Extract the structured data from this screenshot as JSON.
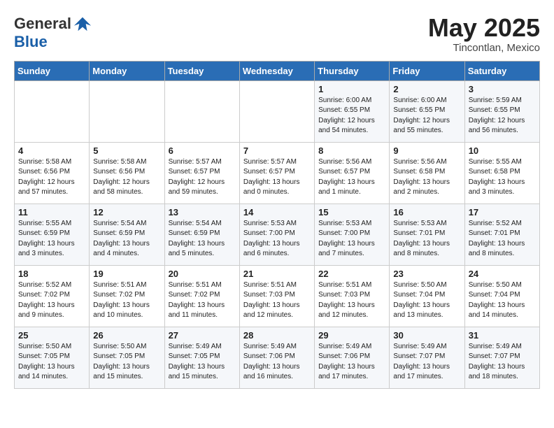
{
  "header": {
    "logo_line1": "General",
    "logo_line2": "Blue",
    "title": "May 2025",
    "subtitle": "Tincontlan, Mexico"
  },
  "weekdays": [
    "Sunday",
    "Monday",
    "Tuesday",
    "Wednesday",
    "Thursday",
    "Friday",
    "Saturday"
  ],
  "weeks": [
    [
      {
        "num": "",
        "info": ""
      },
      {
        "num": "",
        "info": ""
      },
      {
        "num": "",
        "info": ""
      },
      {
        "num": "",
        "info": ""
      },
      {
        "num": "1",
        "info": "Sunrise: 6:00 AM\nSunset: 6:55 PM\nDaylight: 12 hours\nand 54 minutes."
      },
      {
        "num": "2",
        "info": "Sunrise: 6:00 AM\nSunset: 6:55 PM\nDaylight: 12 hours\nand 55 minutes."
      },
      {
        "num": "3",
        "info": "Sunrise: 5:59 AM\nSunset: 6:55 PM\nDaylight: 12 hours\nand 56 minutes."
      }
    ],
    [
      {
        "num": "4",
        "info": "Sunrise: 5:58 AM\nSunset: 6:56 PM\nDaylight: 12 hours\nand 57 minutes."
      },
      {
        "num": "5",
        "info": "Sunrise: 5:58 AM\nSunset: 6:56 PM\nDaylight: 12 hours\nand 58 minutes."
      },
      {
        "num": "6",
        "info": "Sunrise: 5:57 AM\nSunset: 6:57 PM\nDaylight: 12 hours\nand 59 minutes."
      },
      {
        "num": "7",
        "info": "Sunrise: 5:57 AM\nSunset: 6:57 PM\nDaylight: 13 hours\nand 0 minutes."
      },
      {
        "num": "8",
        "info": "Sunrise: 5:56 AM\nSunset: 6:57 PM\nDaylight: 13 hours\nand 1 minute."
      },
      {
        "num": "9",
        "info": "Sunrise: 5:56 AM\nSunset: 6:58 PM\nDaylight: 13 hours\nand 2 minutes."
      },
      {
        "num": "10",
        "info": "Sunrise: 5:55 AM\nSunset: 6:58 PM\nDaylight: 13 hours\nand 3 minutes."
      }
    ],
    [
      {
        "num": "11",
        "info": "Sunrise: 5:55 AM\nSunset: 6:59 PM\nDaylight: 13 hours\nand 3 minutes."
      },
      {
        "num": "12",
        "info": "Sunrise: 5:54 AM\nSunset: 6:59 PM\nDaylight: 13 hours\nand 4 minutes."
      },
      {
        "num": "13",
        "info": "Sunrise: 5:54 AM\nSunset: 6:59 PM\nDaylight: 13 hours\nand 5 minutes."
      },
      {
        "num": "14",
        "info": "Sunrise: 5:53 AM\nSunset: 7:00 PM\nDaylight: 13 hours\nand 6 minutes."
      },
      {
        "num": "15",
        "info": "Sunrise: 5:53 AM\nSunset: 7:00 PM\nDaylight: 13 hours\nand 7 minutes."
      },
      {
        "num": "16",
        "info": "Sunrise: 5:53 AM\nSunset: 7:01 PM\nDaylight: 13 hours\nand 8 minutes."
      },
      {
        "num": "17",
        "info": "Sunrise: 5:52 AM\nSunset: 7:01 PM\nDaylight: 13 hours\nand 8 minutes."
      }
    ],
    [
      {
        "num": "18",
        "info": "Sunrise: 5:52 AM\nSunset: 7:02 PM\nDaylight: 13 hours\nand 9 minutes."
      },
      {
        "num": "19",
        "info": "Sunrise: 5:51 AM\nSunset: 7:02 PM\nDaylight: 13 hours\nand 10 minutes."
      },
      {
        "num": "20",
        "info": "Sunrise: 5:51 AM\nSunset: 7:02 PM\nDaylight: 13 hours\nand 11 minutes."
      },
      {
        "num": "21",
        "info": "Sunrise: 5:51 AM\nSunset: 7:03 PM\nDaylight: 13 hours\nand 12 minutes."
      },
      {
        "num": "22",
        "info": "Sunrise: 5:51 AM\nSunset: 7:03 PM\nDaylight: 13 hours\nand 12 minutes."
      },
      {
        "num": "23",
        "info": "Sunrise: 5:50 AM\nSunset: 7:04 PM\nDaylight: 13 hours\nand 13 minutes."
      },
      {
        "num": "24",
        "info": "Sunrise: 5:50 AM\nSunset: 7:04 PM\nDaylight: 13 hours\nand 14 minutes."
      }
    ],
    [
      {
        "num": "25",
        "info": "Sunrise: 5:50 AM\nSunset: 7:05 PM\nDaylight: 13 hours\nand 14 minutes."
      },
      {
        "num": "26",
        "info": "Sunrise: 5:50 AM\nSunset: 7:05 PM\nDaylight: 13 hours\nand 15 minutes."
      },
      {
        "num": "27",
        "info": "Sunrise: 5:49 AM\nSunset: 7:05 PM\nDaylight: 13 hours\nand 15 minutes."
      },
      {
        "num": "28",
        "info": "Sunrise: 5:49 AM\nSunset: 7:06 PM\nDaylight: 13 hours\nand 16 minutes."
      },
      {
        "num": "29",
        "info": "Sunrise: 5:49 AM\nSunset: 7:06 PM\nDaylight: 13 hours\nand 17 minutes."
      },
      {
        "num": "30",
        "info": "Sunrise: 5:49 AM\nSunset: 7:07 PM\nDaylight: 13 hours\nand 17 minutes."
      },
      {
        "num": "31",
        "info": "Sunrise: 5:49 AM\nSunset: 7:07 PM\nDaylight: 13 hours\nand 18 minutes."
      }
    ]
  ]
}
